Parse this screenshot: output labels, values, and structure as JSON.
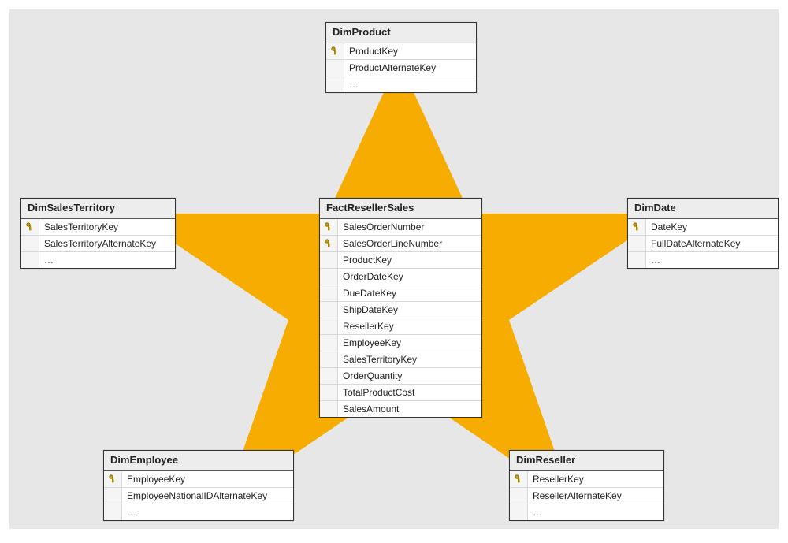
{
  "tables": {
    "dimproduct": {
      "title": "DimProduct",
      "columns": [
        {
          "name": "ProductKey",
          "pk": true
        },
        {
          "name": "ProductAlternateKey",
          "pk": false
        }
      ],
      "more": "…"
    },
    "dimsales_territory": {
      "title": "DimSalesTerritory",
      "columns": [
        {
          "name": "SalesTerritoryKey",
          "pk": true
        },
        {
          "name": "SalesTerritoryAlternateKey",
          "pk": false
        }
      ],
      "more": "…"
    },
    "fact_reseller_sales": {
      "title": "FactResellerSales",
      "columns": [
        {
          "name": "SalesOrderNumber",
          "pk": true
        },
        {
          "name": "SalesOrderLineNumber",
          "pk": true
        },
        {
          "name": "ProductKey",
          "pk": false
        },
        {
          "name": "OrderDateKey",
          "pk": false
        },
        {
          "name": "DueDateKey",
          "pk": false
        },
        {
          "name": "ShipDateKey",
          "pk": false
        },
        {
          "name": "ResellerKey",
          "pk": false
        },
        {
          "name": "EmployeeKey",
          "pk": false
        },
        {
          "name": "SalesTerritoryKey",
          "pk": false
        },
        {
          "name": "OrderQuantity",
          "pk": false
        },
        {
          "name": "TotalProductCost",
          "pk": false
        },
        {
          "name": "SalesAmount",
          "pk": false
        }
      ]
    },
    "dimdate": {
      "title": "DimDate",
      "columns": [
        {
          "name": "DateKey",
          "pk": true
        },
        {
          "name": "FullDateAlternateKey",
          "pk": false
        }
      ],
      "more": "…"
    },
    "dimemployee": {
      "title": "DimEmployee",
      "columns": [
        {
          "name": "EmployeeKey",
          "pk": true
        },
        {
          "name": "EmployeeNationalIDAlternateKey",
          "pk": false
        }
      ],
      "more": "…"
    },
    "dimreseller": {
      "title": "DimReseller",
      "columns": [
        {
          "name": "ResellerKey",
          "pk": true
        },
        {
          "name": "ResellerAlternateKey",
          "pk": false
        }
      ],
      "more": "…"
    }
  }
}
